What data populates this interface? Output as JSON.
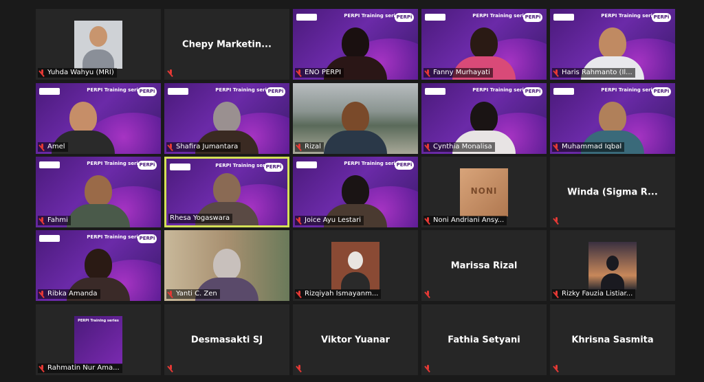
{
  "app": "Zoom Gallery View",
  "series_text": "PERPI Training series",
  "perpi_logo": "PERPi",
  "participants": [
    {
      "name": "Yuhda Wahyu (MRI)",
      "muted": true
    },
    {
      "name": "Chepy Marketin...",
      "muted": true,
      "name_only": true
    },
    {
      "name": "ENO PERPI",
      "muted": true
    },
    {
      "name": "Fanny Murhayati",
      "muted": true
    },
    {
      "name": "Haris Rahmanto (Il...",
      "muted": true
    },
    {
      "name": "Amel",
      "muted": true
    },
    {
      "name": "Shafira Jumantara",
      "muted": true
    },
    {
      "name": "Rizal",
      "muted": true
    },
    {
      "name": "Cynthia Monalisa",
      "muted": true
    },
    {
      "name": "Muhammad Iqbal",
      "muted": true
    },
    {
      "name": "Fahmi",
      "muted": true
    },
    {
      "name": "Rhesa Yogaswara",
      "muted": false,
      "active": true
    },
    {
      "name": "Joice Ayu Lestari",
      "muted": true
    },
    {
      "name": "Noni Andriani Ansy...",
      "muted": true
    },
    {
      "name": "Winda (Sigma R...",
      "muted": true,
      "name_only": true
    },
    {
      "name": "Ribka Amanda",
      "muted": true
    },
    {
      "name": "Yanti C. Zen",
      "muted": true
    },
    {
      "name": "Rizqiyah Ismayanm...",
      "muted": true
    },
    {
      "name": "Marissa Rizal",
      "muted": true,
      "name_only": true
    },
    {
      "name": "Rizky Fauzia Listiar...",
      "muted": true
    },
    {
      "name": "Rahmatin Nur Ama...",
      "muted": true
    },
    {
      "name": "Desmasakti SJ",
      "muted": true,
      "name_only": true
    },
    {
      "name": "Viktor Yuanar",
      "muted": true,
      "name_only": true
    },
    {
      "name": "Fathia Setyani",
      "muted": true,
      "name_only": true
    },
    {
      "name": "Khrisna Sasmita",
      "muted": true,
      "name_only": true
    }
  ],
  "thumb_text": {
    "noni": "NONI"
  },
  "colors": {
    "active_border": "#d4e157",
    "muted_icon": "#e53935",
    "tile_bg": "#262626"
  }
}
